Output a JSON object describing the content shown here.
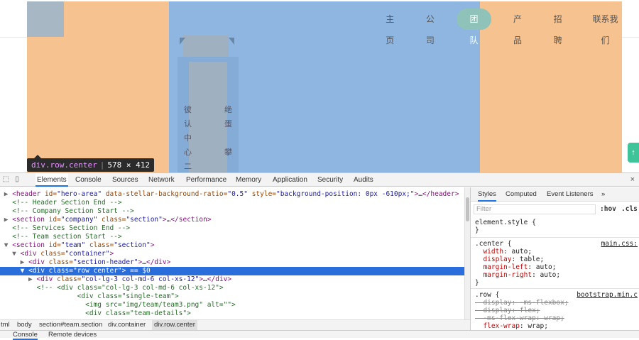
{
  "page": {
    "nav": [
      "主页",
      "公司",
      "团队",
      "产品",
      "招聘",
      "联系我们"
    ],
    "active_nav_index": 2,
    "vertical_chars_left": [
      "彼",
      "认",
      "中",
      "心",
      "二"
    ],
    "vertical_chars_right": [
      "绝",
      "蛋",
      "",
      "攀",
      ""
    ],
    "scroll_top_icon": "up-arrow-icon",
    "scroll_top_glyph": "↑"
  },
  "tooltip": {
    "node": "div.row.center",
    "size": "578 × 412"
  },
  "devtools": {
    "tabs": [
      "Elements",
      "Console",
      "Sources",
      "Network",
      "Performance",
      "Memory",
      "Application",
      "Security",
      "Audits"
    ],
    "active_tab": "Elements",
    "close_glyph": "×",
    "styles_tabs": [
      "Styles",
      "Computed",
      "Event Listeners"
    ],
    "styles_more": "»",
    "filter_placeholder": "Filter",
    "hov": ":hov",
    "cls": ".cls",
    "element_style": "element.style {",
    "element_style_close": "}",
    "center_rule": {
      "selector": ".center {",
      "source": "main.css:",
      "props": [
        {
          "name": "width",
          "value": "auto;"
        },
        {
          "name": "display",
          "value": "table;"
        },
        {
          "name": "margin-left",
          "value": "auto;"
        },
        {
          "name": "margin-right",
          "value": "auto;"
        }
      ],
      "close": "}"
    },
    "row_rule": {
      "selector": ".row {",
      "source": "bootstrap.min.c",
      "props": [
        {
          "name": "display",
          "value": "-ms-flexbox;",
          "struck": true
        },
        {
          "name": "display",
          "value": "flex;",
          "struck": true
        },
        {
          "name": "-ms-flex-wrap",
          "value": "wrap;",
          "struck": true
        },
        {
          "name": "flex-wrap",
          "value": "wrap;",
          "struck": false
        }
      ]
    },
    "breadcrumb": [
      "tml",
      "body",
      "section#team.section",
      "div.container",
      "div.row.center"
    ],
    "drawer_tabs": [
      "Console",
      "Remote devices"
    ],
    "dom_lines": [
      {
        "indent": 1,
        "tri": "▶",
        "html": "<header id=\"hero-area\" data-stellar-background-ratio=\"0.5\" style=\"background-position: 0px -610px;\">…</header>"
      },
      {
        "indent": 1,
        "tri": "",
        "html": "<!-- Header Section End -->",
        "comment": true
      },
      {
        "indent": 1,
        "tri": "",
        "html": "<!-- Company Section Start -->",
        "comment": true
      },
      {
        "indent": 1,
        "tri": "▶",
        "html": "<section id=\"company\" class=\"section\">…</section>"
      },
      {
        "indent": 1,
        "tri": "",
        "html": "<!-- Services Section End -->",
        "comment": true
      },
      {
        "indent": 1,
        "tri": "",
        "html": "<!-- Team section Start -->",
        "comment": true
      },
      {
        "indent": 1,
        "tri": "▼",
        "html": "<section id=\"team\" class=\"section\">"
      },
      {
        "indent": 2,
        "tri": "▼",
        "html": "<div class=\"container\">"
      },
      {
        "indent": 3,
        "tri": "▶",
        "html": "<div class=\"section-header\">…</div>"
      },
      {
        "indent": 3,
        "tri": "▼",
        "html": "<div class=\"row center\"> == $0",
        "selected": true
      },
      {
        "indent": 4,
        "tri": "▶",
        "html": "<div class=\"col-lg-3 col-md-6 col-xs-12\">…</div>"
      },
      {
        "indent": 4,
        "tri": "",
        "html": "<!-- <div class=\"col-lg-3 col-md-6 col-xs-12\">",
        "comment": true
      },
      {
        "indent": 9,
        "tri": "",
        "html": "<div class=\"single-team\">",
        "comment": true
      },
      {
        "indent": 10,
        "tri": "",
        "html": "<img src=\"img/team/team3.png\" alt=\"\">",
        "comment": true
      },
      {
        "indent": 10,
        "tri": "",
        "html": "<div class=\"team-details\">",
        "comment": true
      }
    ]
  }
}
